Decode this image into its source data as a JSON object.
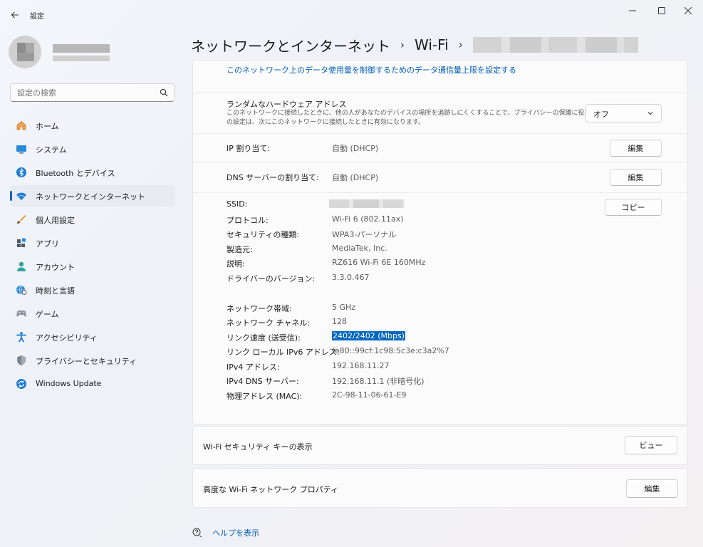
{
  "window": {
    "title": "設定"
  },
  "sidebar": {
    "search_placeholder": "設定の検索",
    "items": [
      {
        "label": "ホーム",
        "icon": "home-icon"
      },
      {
        "label": "システム",
        "icon": "system-icon"
      },
      {
        "label": "Bluetooth とデバイス",
        "icon": "bluetooth-icon"
      },
      {
        "label": "ネットワークとインターネット",
        "icon": "wifi-icon",
        "active": true
      },
      {
        "label": "個人用設定",
        "icon": "brush-icon"
      },
      {
        "label": "アプリ",
        "icon": "apps-icon"
      },
      {
        "label": "アカウント",
        "icon": "account-icon"
      },
      {
        "label": "時刻と言語",
        "icon": "globe-clock-icon"
      },
      {
        "label": "ゲーム",
        "icon": "gamepad-icon"
      },
      {
        "label": "アクセシビリティ",
        "icon": "accessibility-icon"
      },
      {
        "label": "プライバシーとセキュリティ",
        "icon": "shield-icon"
      },
      {
        "label": "Windows Update",
        "icon": "windows-update-icon"
      }
    ]
  },
  "breadcrumb": {
    "part1": "ネットワークとインターネット",
    "part2": "Wi-Fi"
  },
  "main": {
    "data_limit_link": "このネットワーク上のデータ使用量を制御するためのデータ通信量上限を設定する",
    "random_hw": {
      "title": "ランダムなハードウェア アドレス",
      "desc1": "このネットワークに接続したときに、他の人があなたのデバイスの場所を追跡しにくくすることで、プライバシーの保護に役立ちます。こ",
      "desc2": "の設定は、次にこのネットワークに接続したときに有効になります。",
      "value": "オフ"
    },
    "ip": {
      "label": "IP 割り当て:",
      "value": "自動 (DHCP)",
      "button": "編集"
    },
    "dns": {
      "label": "DNS サーバーの割り当て:",
      "value": "自動 (DHCP)",
      "button": "編集"
    },
    "copy_button": "コピー",
    "props": [
      {
        "label": "SSID:",
        "value": ""
      },
      {
        "label": "プロトコル:",
        "value": "Wi-Fi 6 (802.11ax)"
      },
      {
        "label": "セキュリティの種類:",
        "value": "WPA3-パーソナル"
      },
      {
        "label": "製造元:",
        "value": "MediaTek, Inc."
      },
      {
        "label": "説明:",
        "value": "RZ616 Wi-Fi 6E 160MHz"
      },
      {
        "label": "ドライバーのバージョン:",
        "value": "3.3.0.467"
      },
      {
        "label": "ネットワーク帯域:",
        "value": "5 GHz"
      },
      {
        "label": "ネットワーク チャネル:",
        "value": "128"
      },
      {
        "label": "リンク速度 (送受信):",
        "value": "2402/2402 (Mbps)"
      },
      {
        "label": "リンク ローカル IPv6 アドレス:",
        "value": "fe80::99cf:1c98:5c3e:c3a2%7"
      },
      {
        "label": "IPv4 アドレス:",
        "value": "192.168.11.27"
      },
      {
        "label": "IPv4 DNS サーバー:",
        "value": "192.168.11.1 (非暗号化)"
      },
      {
        "label": "物理アドレス (MAC):",
        "value": "2C-98-11-06-61-E9"
      }
    ],
    "security_key": {
      "label": "Wi-Fi セキュリティ キーの表示",
      "button": "ビュー"
    },
    "advanced": {
      "label": "高度な Wi-Fi ネットワーク プロパティ",
      "button": "編集"
    },
    "help": "ヘルプを表示"
  },
  "colors": {
    "accent": "#0067c0",
    "link": "#005fb8"
  }
}
